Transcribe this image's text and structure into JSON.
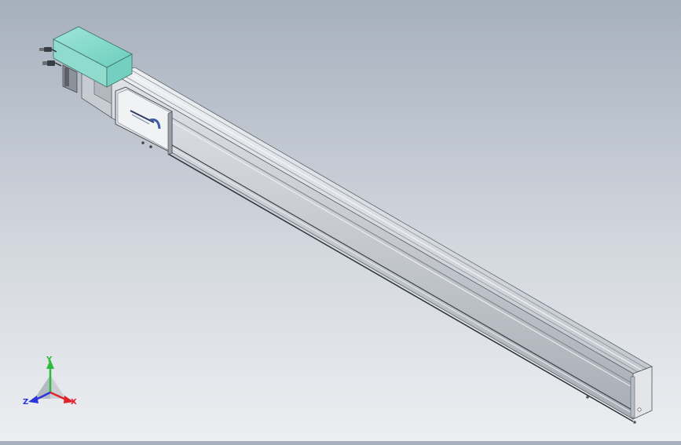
{
  "viewport": {
    "background_top": "#a6b0bd",
    "background_bottom": "#eceef1"
  },
  "model": {
    "motor_color": "#7fd6c8",
    "rail_color": "#c9cdd3",
    "carriage_logo_text": "",
    "icons": [
      "motor-housing",
      "connector-cables",
      "linear-rail",
      "carriage-plate",
      "end-cap"
    ]
  },
  "triad": {
    "x_label": "X",
    "y_label": "Y",
    "z_label": "Z",
    "x_color": "#e0222a",
    "y_color": "#2dbb3a",
    "z_color": "#2a35d8"
  }
}
